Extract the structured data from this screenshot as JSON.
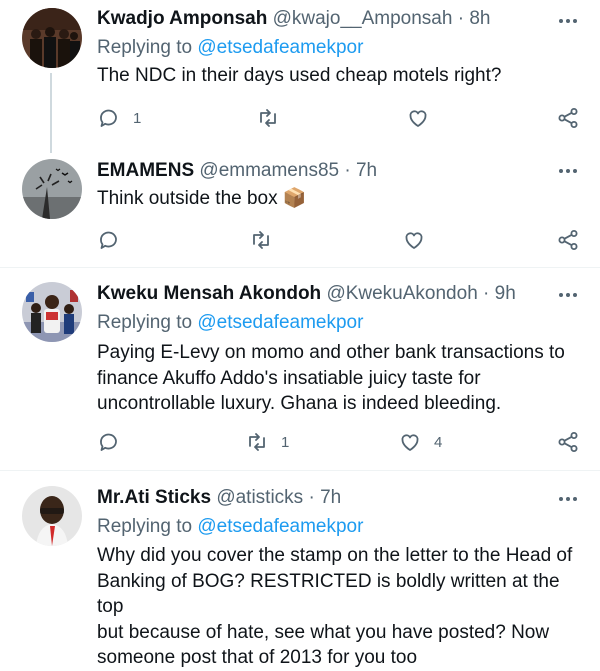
{
  "tweets": [
    {
      "name": "Kwadjo Amponsah",
      "handle": "@kwajo__Amponsah",
      "dot": "·",
      "time": "8h",
      "replying_prefix": "Replying to",
      "replying_to": "@etsedafeamekpor",
      "text": "The NDC in their days used cheap motels right?",
      "reply_count": "1",
      "retweet_count": "",
      "like_count": ""
    },
    {
      "name": "EMAMENS",
      "handle": "@emmamens85",
      "dot": "·",
      "time": "7h",
      "text": "Think outside the box 📦",
      "reply_count": "",
      "retweet_count": "",
      "like_count": ""
    },
    {
      "name": "Kweku Mensah Akondoh",
      "handle": "@KwekuAkondoh",
      "dot": "·",
      "time": "9h",
      "replying_prefix": "Replying to",
      "replying_to": "@etsedafeamekpor",
      "text_lines": [
        "Paying E-Levy on momo and other bank transactions to",
        "finance Akuffo Addo's insatiable juicy taste for",
        "uncontrollable luxury. Ghana is indeed bleeding."
      ],
      "reply_count": "",
      "retweet_count": "1",
      "like_count": "4"
    },
    {
      "name": "Mr.Ati Sticks",
      "handle": "@atisticks",
      "dot": "·",
      "time": "7h",
      "replying_prefix": "Replying to",
      "replying_to": "@etsedafeamekpor",
      "text_lines": [
        "Why did you cover the stamp on the letter to the Head of",
        "Banking of BOG? RESTRICTED is boldly written at the top",
        "but because of hate, see what you have posted? Now",
        "someone post that of 2013 for you too"
      ]
    }
  ],
  "colors": {
    "link": "#1d9bf0",
    "secondary_text": "#536471",
    "primary_text": "#0f1419",
    "separator": "#eff3f4"
  },
  "icons": [
    "reply-icon",
    "retweet-icon",
    "like-icon",
    "share-icon",
    "more-icon"
  ]
}
